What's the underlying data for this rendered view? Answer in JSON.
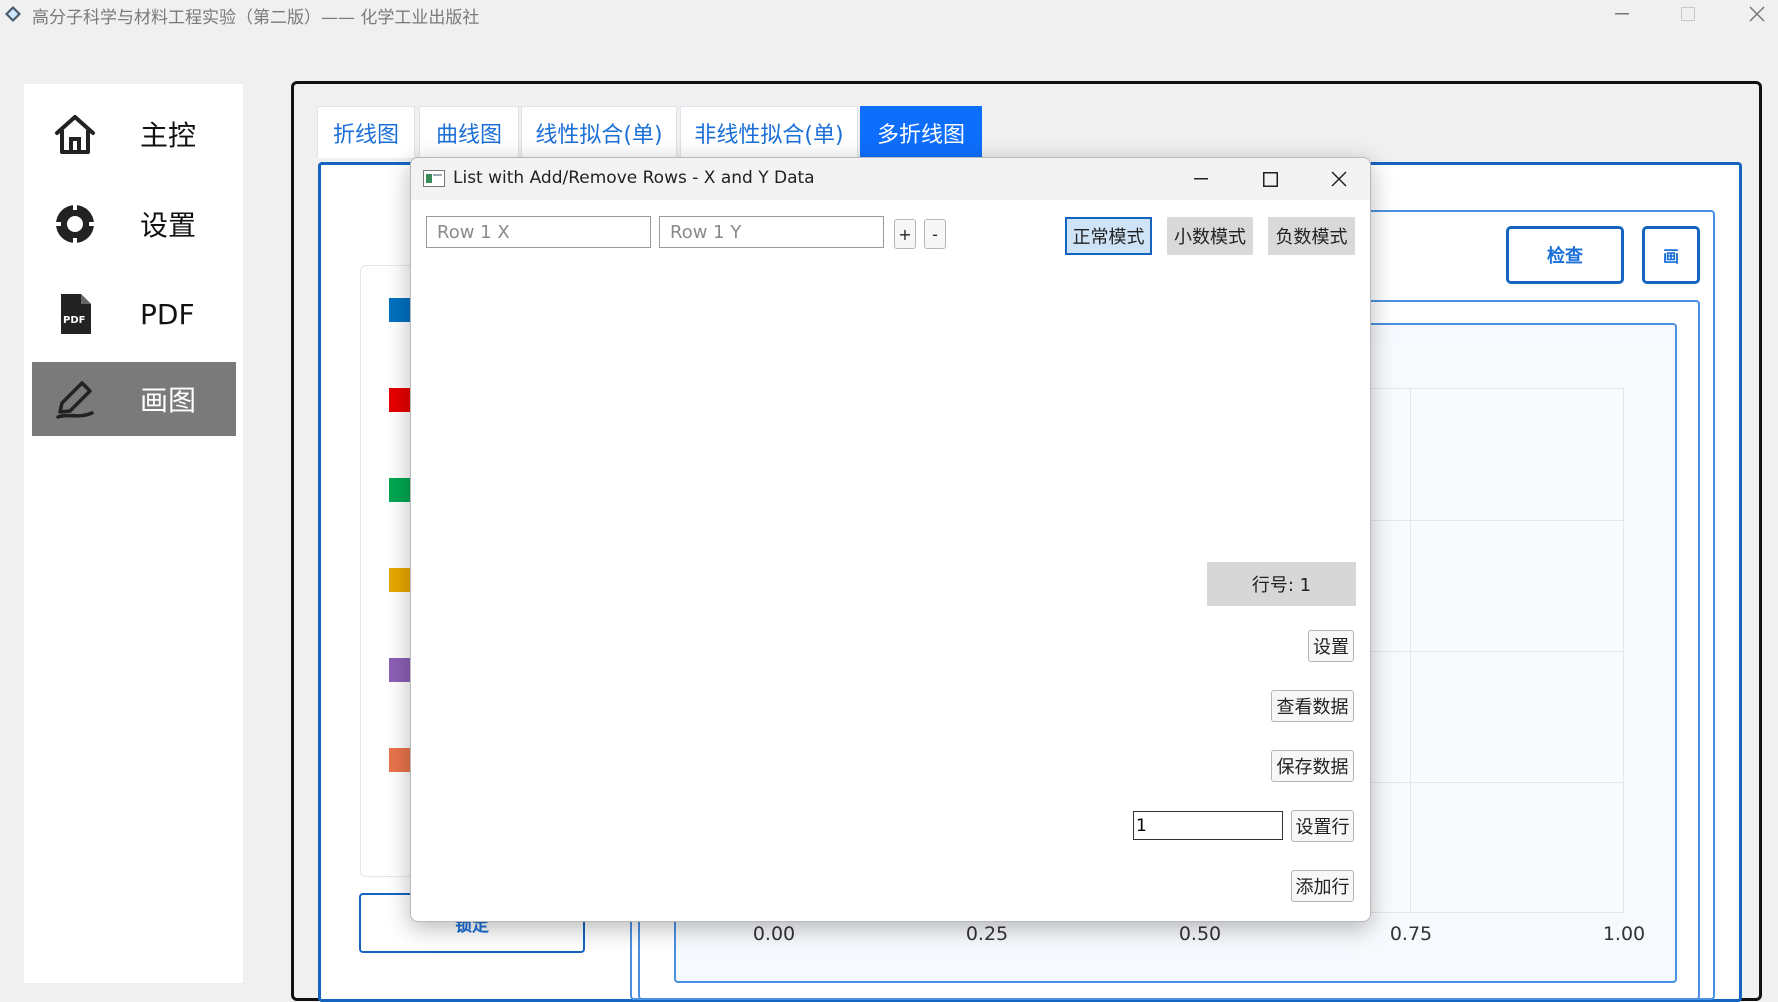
{
  "app": {
    "title": "高分子科学与材料工程实验（第二版）—— 化学工业出版社"
  },
  "sidebar": {
    "items": [
      {
        "label": "主控",
        "icon": "home-icon"
      },
      {
        "label": "设置",
        "icon": "gear-icon"
      },
      {
        "label": "PDF",
        "icon": "pdf-file-icon"
      },
      {
        "label": "画图",
        "icon": "pen-icon",
        "active": true
      }
    ]
  },
  "tabs": [
    {
      "label": "折线图"
    },
    {
      "label": "曲线图"
    },
    {
      "label": "线性拟合(单)"
    },
    {
      "label": "非线性拟合(单)"
    },
    {
      "label": "多折线图",
      "active": true
    }
  ],
  "background": {
    "lock_label": "锁定",
    "check_label": "检查",
    "draw_label": "画",
    "legend_colors": [
      "#0070c0",
      "#e60000",
      "#00a651",
      "#e6a800",
      "#8c5fb5",
      "#e8734a"
    ],
    "x_ticks": [
      "0.00",
      "0.25",
      "0.50",
      "0.75",
      "1.00"
    ]
  },
  "dialog": {
    "title": "List with Add/Remove Rows - X and Y Data",
    "x_placeholder": "Row 1 X",
    "y_placeholder": "Row 1 Y",
    "add_label": "+",
    "remove_label": "-",
    "modes": [
      {
        "label": "正常模式",
        "active": true
      },
      {
        "label": "小数模式"
      },
      {
        "label": "负数模式"
      }
    ],
    "row_number": "行号: 1",
    "settings_label": "设置",
    "view_data_label": "查看数据",
    "save_data_label": "保存数据",
    "set_row_value": "1",
    "set_row_label": "设置行",
    "add_row_label": "添加行"
  }
}
